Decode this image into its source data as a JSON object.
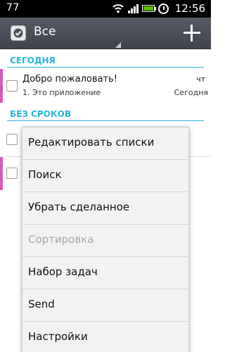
{
  "status_bar": {
    "left_text": "77",
    "time": "12:56",
    "icons": [
      "wifi-icon",
      "signal-icon",
      "battery-icon",
      "alarm-icon"
    ]
  },
  "action_bar": {
    "title": "Все",
    "icons": [
      "app-check-icon",
      "add-icon"
    ]
  },
  "sections": [
    {
      "label": "СЕГОДНЯ"
    },
    {
      "label": "БЕЗ СРОКОВ"
    }
  ],
  "tasks": [
    {
      "title": "Добро пожаловать!",
      "note": "1. Это приложение",
      "day": "чт",
      "date": "Сегодня"
    }
  ],
  "menu": {
    "items": [
      {
        "label": "Редактировать списки",
        "enabled": true
      },
      {
        "label": "Поиск",
        "enabled": true
      },
      {
        "label": "Убрать сделанное",
        "enabled": true
      },
      {
        "label": "Сортировка",
        "enabled": false
      },
      {
        "label": "Набор задач",
        "enabled": true
      },
      {
        "label": "Send",
        "enabled": true
      },
      {
        "label": "Настройки",
        "enabled": true
      }
    ]
  },
  "colors": {
    "accent": "#2cb4dc",
    "priority": "#d659b9",
    "action_bar": "#4a4f57"
  }
}
